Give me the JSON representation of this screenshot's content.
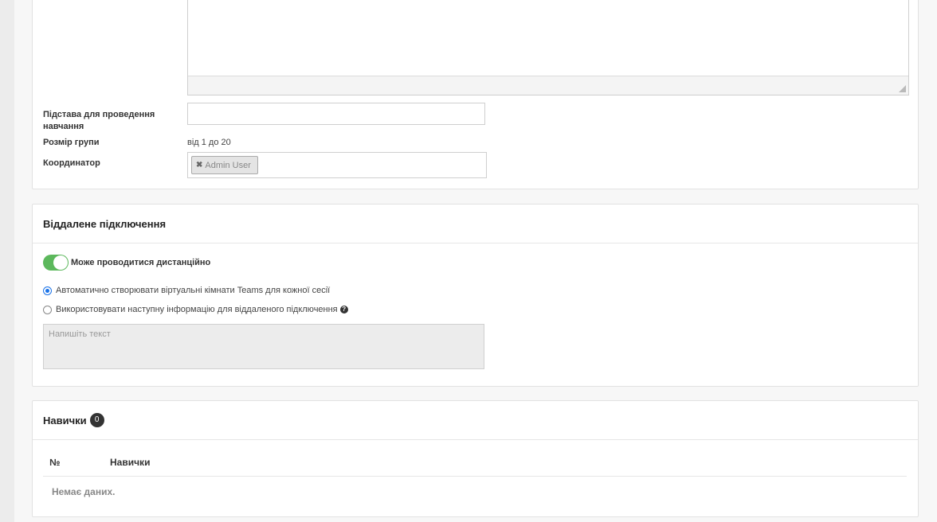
{
  "details": {
    "basis_label": "Підстава для проведення навчання",
    "basis_value": "",
    "group_size_label": "Розмір групи",
    "group_size_value": "від 1 до 20",
    "coordinator_label": "Координатор",
    "coordinator_tag": "Admin User",
    "coordinator_tag_remove": "✖"
  },
  "remote": {
    "title": "Віддалене підключення",
    "toggle_label": "Може проводитися дистанційно",
    "toggle_on": true,
    "option_auto": "Автоматично створювати віртуальні кімнати Teams для кожної сесії",
    "option_manual": "Використовувати наступну інформацію для віддаленого підключення",
    "help_icon": "?",
    "textarea_placeholder": "Напишіть текст"
  },
  "skills": {
    "title": "Навички",
    "count": "0",
    "columns": [
      "№",
      "Навички"
    ],
    "empty_text": "Немає даних."
  },
  "colors": {
    "toggle_on": "#5cb85c",
    "radio_selected": "#1a73e8",
    "badge": "#333333"
  }
}
